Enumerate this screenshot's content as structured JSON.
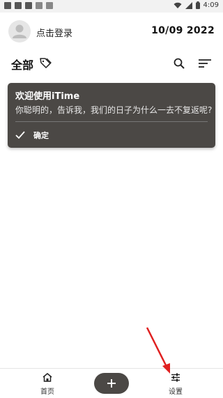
{
  "status_bar": {
    "time": "4:09"
  },
  "header": {
    "login_label": "点击登录",
    "date": "10/09 2022"
  },
  "category": {
    "title": "全部"
  },
  "dialog": {
    "title": "欢迎使用iTime",
    "message": "你聪明的，告诉我，我们的日子为什么一去不复返呢?",
    "confirm_label": "确定"
  },
  "bottom_nav": {
    "home_label": "首页",
    "settings_label": "设置"
  },
  "colors": {
    "card_bg": "#4b4845",
    "annotation_arrow": "#e02020"
  }
}
